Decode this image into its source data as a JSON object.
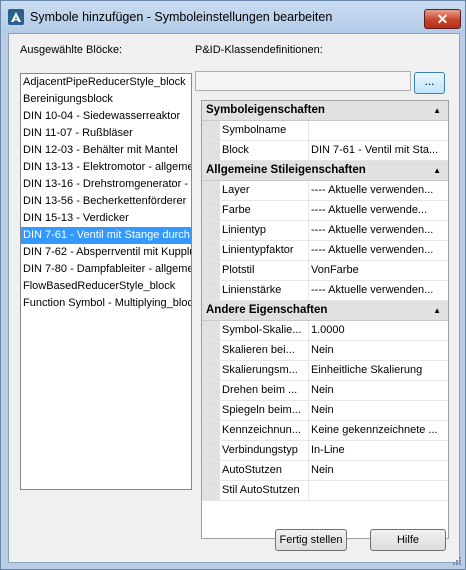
{
  "window": {
    "title": "Symbole hinzufügen - Symboleinstellungen bearbeiten",
    "close_label": "✕"
  },
  "labels": {
    "selected_blocks": "Ausgewählte Blöcke:",
    "class_definitions": "P&ID-Klassendefinitionen:"
  },
  "blocks": [
    {
      "label": "AdjacentPipeReducerStyle_block",
      "selected": false
    },
    {
      "label": "Bereinigungsblock",
      "selected": false
    },
    {
      "label": "DIN 10-04 - Siedewasserreaktor",
      "selected": false
    },
    {
      "label": "DIN 11-07 - Rußbläser",
      "selected": false
    },
    {
      "label": "DIN 12-03 - Behälter mit Mantel",
      "selected": false
    },
    {
      "label": "DIN 13-13 - Elektromotor - allgemei",
      "selected": false
    },
    {
      "label": "DIN 13-16 - Drehstromgenerator -",
      "selected": false
    },
    {
      "label": "DIN 13-56 - Becherkettenförderer",
      "selected": false
    },
    {
      "label": "DIN 15-13 - Verdicker",
      "selected": false
    },
    {
      "label": "DIN 7-61 - Ventil mit Stange durch",
      "selected": true
    },
    {
      "label": "DIN 7-62 - Absperrventil mit Kupplu",
      "selected": false
    },
    {
      "label": "DIN 7-80 - Dampfableiter - allgemei",
      "selected": false
    },
    {
      "label": "FlowBasedReducerStyle_block",
      "selected": false
    },
    {
      "label": "Function Symbol - Multiplying_block",
      "selected": false
    }
  ],
  "class_definition": {
    "value": "",
    "browse_label": "..."
  },
  "properties": [
    {
      "category": "Symboleigenschaften",
      "rows": [
        {
          "name": "Symbolname",
          "value": ""
        },
        {
          "name": "Block",
          "value": "DIN 7-61 - Ventil mit Sta..."
        }
      ]
    },
    {
      "category": "Allgemeine Stileigenschaften",
      "rows": [
        {
          "name": "Layer",
          "value": "---- Aktuelle verwenden..."
        },
        {
          "name": "Farbe",
          "value": "---- Aktuelle verwende..."
        },
        {
          "name": "Linientyp",
          "value": "---- Aktuelle verwenden..."
        },
        {
          "name": "Linientypfaktor",
          "value": "---- Aktuelle verwenden..."
        },
        {
          "name": "Plotstil",
          "value": "VonFarbe"
        },
        {
          "name": "Linienstärke",
          "value": "---- Aktuelle verwenden..."
        }
      ]
    },
    {
      "category": "Andere Eigenschaften",
      "rows": [
        {
          "name": "Symbol-Skalie...",
          "value": "1.0000"
        },
        {
          "name": "Skalieren bei...",
          "value": "Nein"
        },
        {
          "name": "Skalierungsm...",
          "value": "Einheitliche Skalierung"
        },
        {
          "name": "Drehen beim ...",
          "value": "Nein"
        },
        {
          "name": "Spiegeln beim...",
          "value": "Nein"
        },
        {
          "name": "Kennzeichnun...",
          "value": "Keine gekennzeichnete ..."
        },
        {
          "name": "Verbindungstyp",
          "value": "In-Line"
        },
        {
          "name": "AutoStutzen",
          "value": "Nein"
        },
        {
          "name": "Stil AutoStutzen",
          "value": ""
        }
      ]
    }
  ],
  "buttons": {
    "finish": "Fertig stellen",
    "help": "Hilfe"
  },
  "icons": {
    "app": "autocad-plant-icon",
    "collapse": "collapse-arrow-icon",
    "resize": "resize-grip-icon"
  }
}
